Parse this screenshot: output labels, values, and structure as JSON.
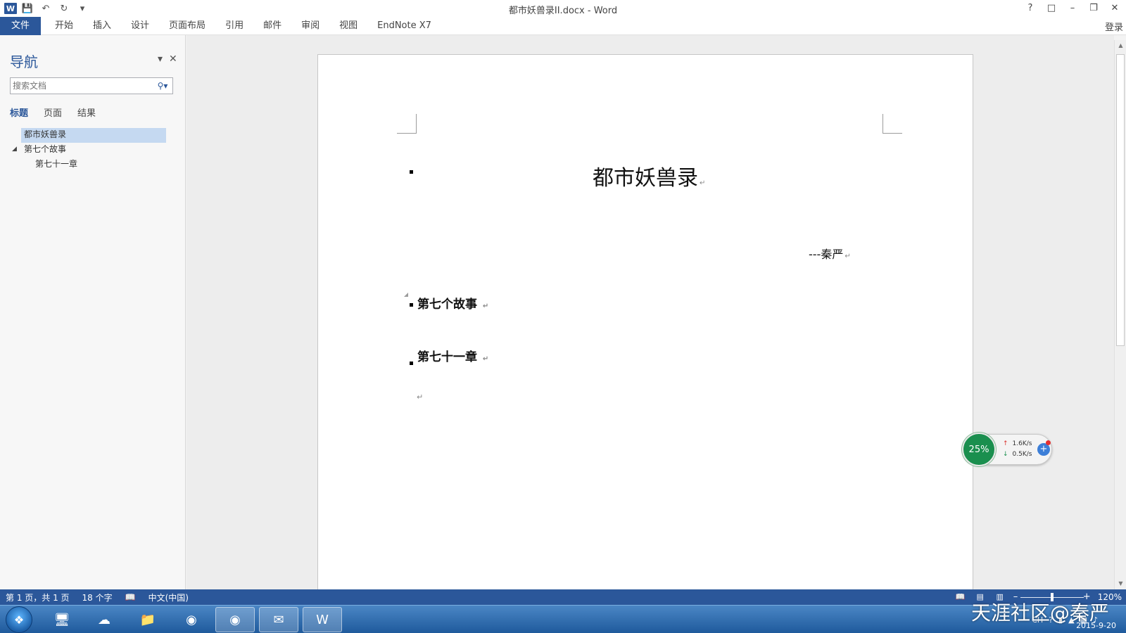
{
  "window": {
    "title": "都市妖兽录II.docx - Word",
    "login": "登录"
  },
  "ribbon": {
    "tabs": [
      "文件",
      "开始",
      "插入",
      "设计",
      "页面布局",
      "引用",
      "邮件",
      "审阅",
      "视图",
      "EndNote X7"
    ]
  },
  "nav": {
    "title": "导航",
    "search_placeholder": "搜索文档",
    "tabs": [
      "标题",
      "页面",
      "结果"
    ],
    "tree": [
      {
        "label": "都市妖兽录",
        "level": 0,
        "selected": true
      },
      {
        "label": "第七个故事",
        "level": 1,
        "expanded": true
      },
      {
        "label": "第七十一章",
        "level": 2
      }
    ]
  },
  "document": {
    "heading": "都市妖兽录",
    "author": "---秦严",
    "section1": "第七个故事",
    "section2": "第七十一章",
    "paragraph_mark": "↵"
  },
  "netmon": {
    "percent": "25%",
    "up": "1.6K/s",
    "down": "0.5K/s"
  },
  "status": {
    "page": "第 1 页，共 1 页",
    "words": "18 个字",
    "language": "中文(中国)",
    "zoom": "120%",
    "zoom_fraction": 0.5
  },
  "taskbar": {
    "tray_lang": "CH",
    "date": "2015-9-20",
    "watermark": "天涯社区@秦严"
  },
  "colors": {
    "accent": "#2b579a",
    "nav_selected": "#c5d9f1",
    "netmon_green": "#1a8f4e"
  }
}
